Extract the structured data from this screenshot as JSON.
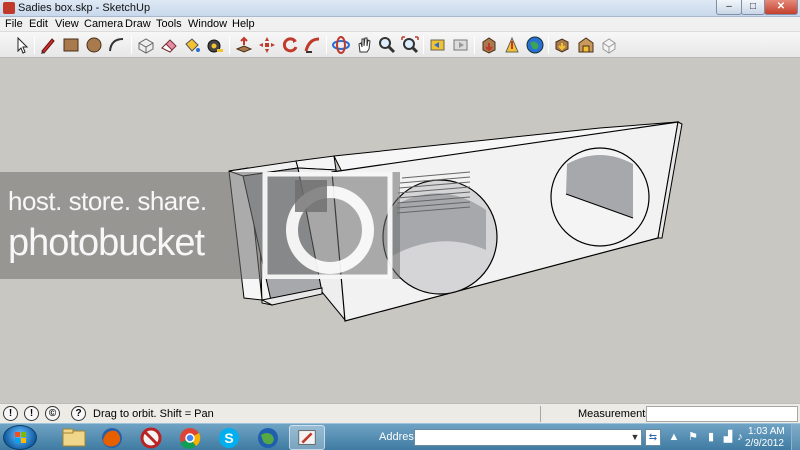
{
  "window": {
    "title": "Sadies box.skp - SketchUp",
    "minimize_glyph": "–",
    "maximize_glyph": "□",
    "close_glyph": "✕"
  },
  "menu": {
    "items": [
      "File",
      "Edit",
      "View",
      "Camera",
      "Draw",
      "Tools",
      "Window",
      "Help"
    ]
  },
  "toolbar": {
    "icons": [
      "select-icon",
      "pencil-icon",
      "rectangle-icon",
      "circle-icon",
      "arc-icon",
      "make-component-icon",
      "eraser-icon",
      "paint-bucket-icon",
      "tape-measure-icon",
      "push-pull-icon",
      "move-icon",
      "rotate-icon",
      "follow-me-icon",
      "orbit-icon",
      "pan-icon",
      "zoom-icon",
      "zoom-extents-icon",
      "previous-view-icon",
      "next-view-icon",
      "get-models-icon",
      "share-model-icon",
      "google-earth-icon",
      "components-icon",
      "warehouse-icon",
      "extension-icon"
    ]
  },
  "watermark": {
    "line1": "host. store. share.",
    "line2": "photobucket"
  },
  "status": {
    "hint": "Drag to orbit.  Shift = Pan",
    "measurements_label": "Measurements",
    "measurements_value": "",
    "icon_geo": "!",
    "icon_credits": "!",
    "icon_account": "©",
    "icon_help": "?"
  },
  "taskbar": {
    "address_label": "Address",
    "address_value": "",
    "address_drop_glyph": "▼",
    "address_go_glyph": "⇆",
    "time": "1:03 AM",
    "date": "2/9/2012",
    "tray_flag": "⚑",
    "tray_volume": "♪",
    "tray_battery": "▮",
    "tray_network": "▟",
    "tray_chevron": "▲",
    "apps": [
      "explorer",
      "firefox",
      "blocked-app",
      "chrome",
      "skype",
      "google-earth",
      "sketchup"
    ],
    "active_app": "sketchup"
  },
  "colors": {
    "viewport_bg": "#c9c7c1",
    "face_white": "#f4f4f4",
    "face_gray": "#a7a8ab",
    "edge": "#000000",
    "taskbar": "#4a86ad"
  }
}
